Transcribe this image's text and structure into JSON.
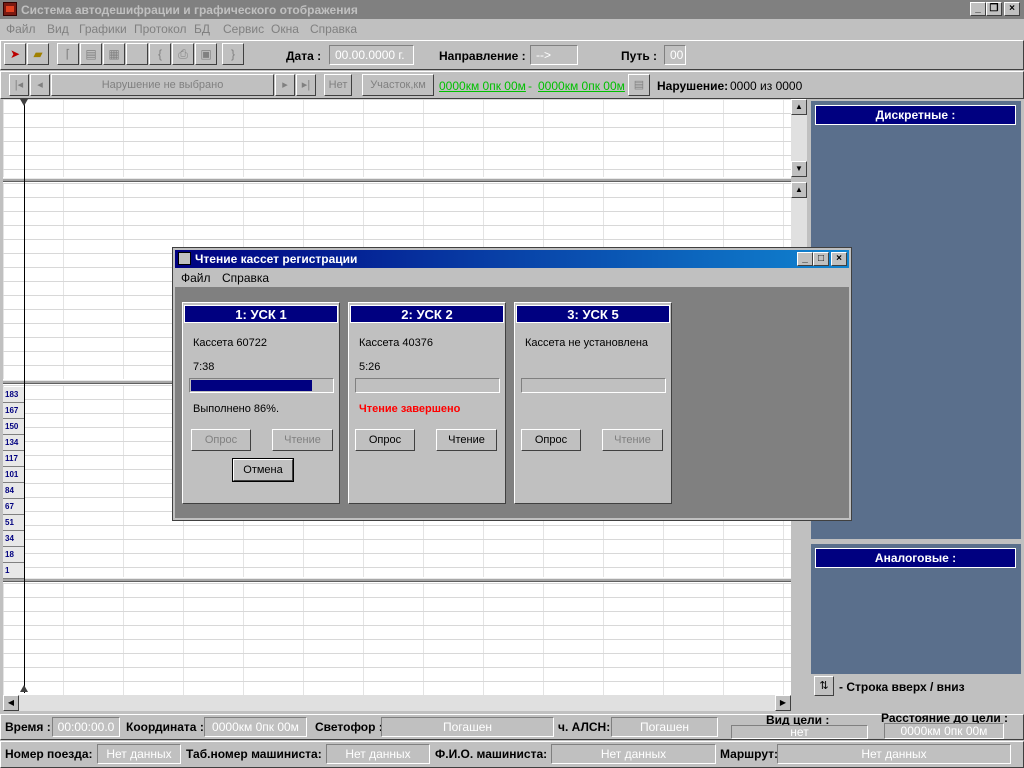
{
  "app": {
    "title": "Система автодешифрации и графического отображения"
  },
  "menu": {
    "items": [
      "Файл",
      "Вид",
      "Графики",
      "Протокол",
      "БД",
      "Сервис",
      "Окна",
      "Справка"
    ]
  },
  "toolbar": {
    "date_label": "Дата :",
    "date_value": "00.00.0000 г.",
    "direction_label": "Направление :",
    "direction_value": "-->",
    "path_label": "Путь :",
    "path_value": "00"
  },
  "violation_bar": {
    "selected": "Нарушение не выбрано",
    "net_button": "Нет",
    "section_button": "Участок,км",
    "from_km": "0000км 0пк 00м",
    "dash": "-",
    "to_km": "0000км 0пк 00м",
    "violation_label": "Нарушение:",
    "violation_count": "0000 из 0000"
  },
  "scale": [
    "183",
    "167",
    "150",
    "134",
    "117",
    "101",
    "84",
    "67",
    "51",
    "34",
    "18",
    "1"
  ],
  "right_panels": {
    "discrete_title": "Дискретные :",
    "analog_title": "Аналоговые :",
    "row_hint": "- Строка вверх / вниз"
  },
  "status1": {
    "time_label": "Время :",
    "time_value": "00:00:00.0",
    "coord_label": "Координата :",
    "coord_value": "0000км 0пк 00м",
    "signal_label": "Светофор :",
    "signal_value": "Погашен",
    "alsn_label": "ч. АЛСН:",
    "alsn_value": "Погашен",
    "target_label": "Вид цели :",
    "target_value": "нет",
    "distance_label": "Расстояние до цели :",
    "distance_value": "0000км 0пк 00м"
  },
  "status2": {
    "train_label": "Номер поезда:",
    "train_value": "Нет данных",
    "tab_label": "Таб.номер машиниста:",
    "tab_value": "Нет данных",
    "fio_label": "Ф.И.О. машиниста:",
    "fio_value": "Нет данных",
    "route_label": "Маршрут:",
    "route_value": "Нет данных"
  },
  "dialog": {
    "title": "Чтение кассет регистрации",
    "menu_file": "Файл",
    "menu_help": "Справка",
    "usk": [
      {
        "title": "1: УСК 1",
        "cassette": "Кассета 60722",
        "time": "7:38",
        "progress": 0.86,
        "status": "Выполнено 86%.",
        "poll_label": "Опрос",
        "read_label": "Чтение",
        "cancel_label": "Отмена"
      },
      {
        "title": "2: УСК 2",
        "cassette": "Кассета 40376",
        "time": "5:26",
        "progress": 0,
        "status": "Чтение завершено",
        "poll_label": "Опрос",
        "read_label": "Чтение"
      },
      {
        "title": "3: УСК 5",
        "cassette": "Кассета не установлена",
        "progress": 0,
        "poll_label": "Опрос",
        "read_label": "Чтение"
      }
    ]
  },
  "colors": {
    "accent": "#000080",
    "panel": "#5a6f8c",
    "link": "#00c000",
    "error": "#ff0000"
  }
}
